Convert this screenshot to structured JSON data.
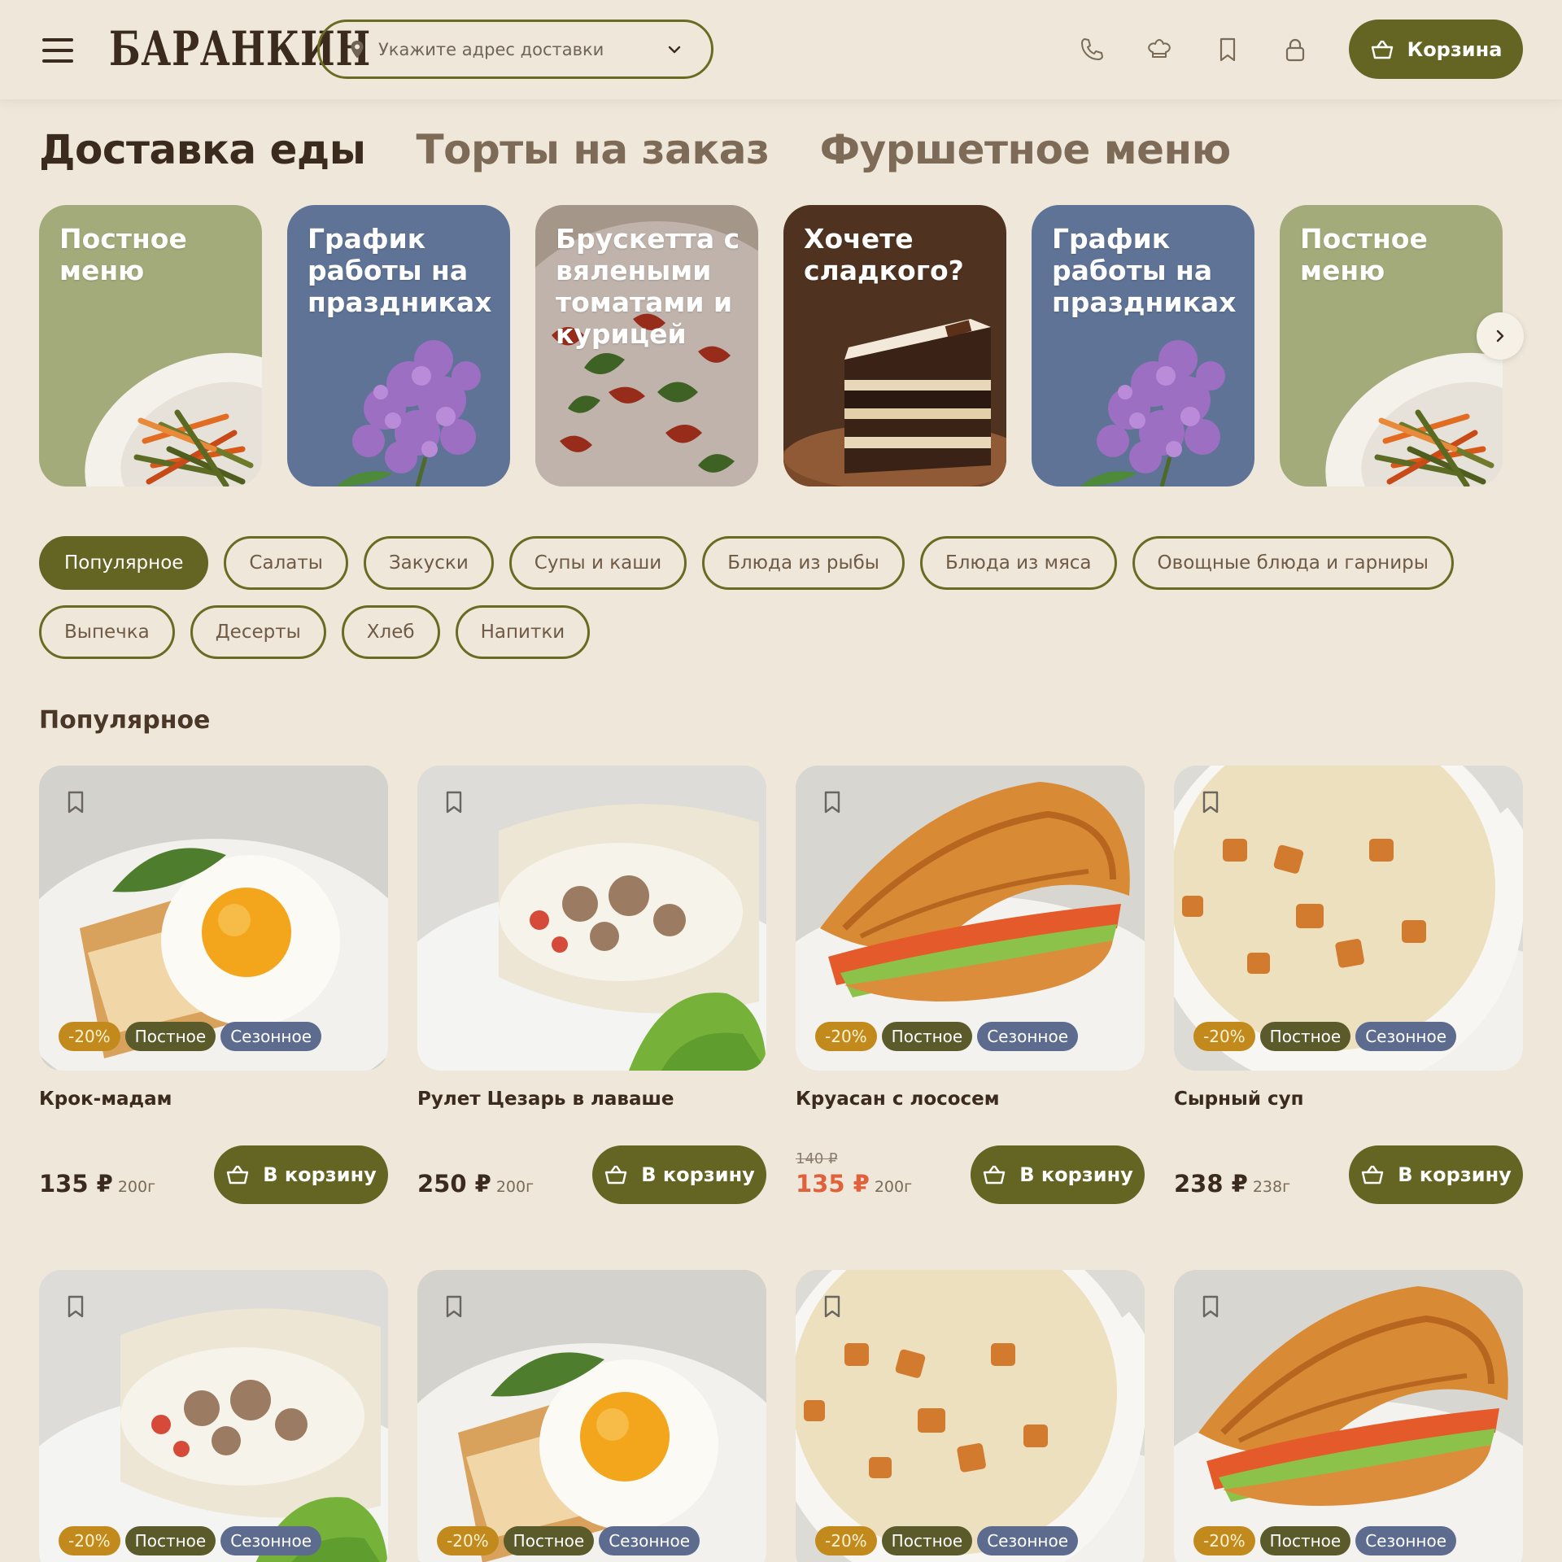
{
  "header": {
    "logo": "БАРАНКИН",
    "address_placeholder": "Укажите адрес доставки",
    "cart_label": "Корзина"
  },
  "tabs": [
    "Доставка еды",
    "Торты на заказ",
    "Фуршетное меню"
  ],
  "promos": [
    {
      "title": "Постное меню",
      "bg": "#a3ab7a",
      "art": "plate-vegetables"
    },
    {
      "title": "График работы на праздниках",
      "bg": "#5e7395",
      "art": "lilac"
    },
    {
      "title": "Брускетта с вялеными томатами и курицей",
      "bg": "#8a4a3a",
      "art": "bruschetta"
    },
    {
      "title": "Хочете сладкого?",
      "bg": "#4f3320",
      "art": "cake"
    },
    {
      "title": "График работы на праздниках",
      "bg": "#5e7395",
      "art": "lilac"
    },
    {
      "title": "Постное меню",
      "bg": "#a3ab7a",
      "art": "plate-vegetables"
    }
  ],
  "chips_rows": [
    [
      "Популярное",
      "Салаты",
      "Закуски",
      "Супы и каши",
      "Блюда из рыбы",
      "Блюда из мяса",
      "Овощные блюда и гарниры"
    ],
    [
      "Выпечка",
      "Десерты",
      "Хлеб",
      "Напитки"
    ]
  ],
  "active_chip": "Популярное",
  "section_title": "Популярное",
  "badges": {
    "discount": "-20%",
    "post": "Постное",
    "seasonal": "Сезонное"
  },
  "add_label": "В корзину",
  "products": [
    {
      "name": "Крок-мадам",
      "price": "135 ₽",
      "weight": "200г",
      "old_price": "",
      "sale": false,
      "badges": true,
      "photo": "egg"
    },
    {
      "name": "Рулет Цезарь в лаваше",
      "price": "250 ₽",
      "weight": "200г",
      "old_price": "",
      "sale": false,
      "badges": false,
      "photo": "wrap"
    },
    {
      "name": "Круасан с лососем",
      "price": "135 ₽",
      "weight": "200г",
      "old_price": "140 ₽",
      "sale": true,
      "badges": true,
      "photo": "croissant"
    },
    {
      "name": "Сырный суп",
      "price": "238 ₽",
      "weight": "238г",
      "old_price": "",
      "sale": false,
      "badges": true,
      "photo": "soup"
    },
    {
      "name": "",
      "price": "",
      "weight": "",
      "old_price": "",
      "sale": false,
      "badges": true,
      "photo": "wrap"
    },
    {
      "name": "",
      "price": "",
      "weight": "",
      "old_price": "",
      "sale": false,
      "badges": true,
      "photo": "egg"
    },
    {
      "name": "",
      "price": "",
      "weight": "",
      "old_price": "",
      "sale": false,
      "badges": true,
      "photo": "soup"
    },
    {
      "name": "",
      "price": "",
      "weight": "",
      "old_price": "",
      "sale": false,
      "badges": true,
      "photo": "croissant"
    }
  ],
  "colors": {
    "accent": "#646423",
    "background": "#efe8da",
    "sale": "#e0623c",
    "seasonal": "#5d6c8e",
    "discount": "#c28a1c"
  }
}
